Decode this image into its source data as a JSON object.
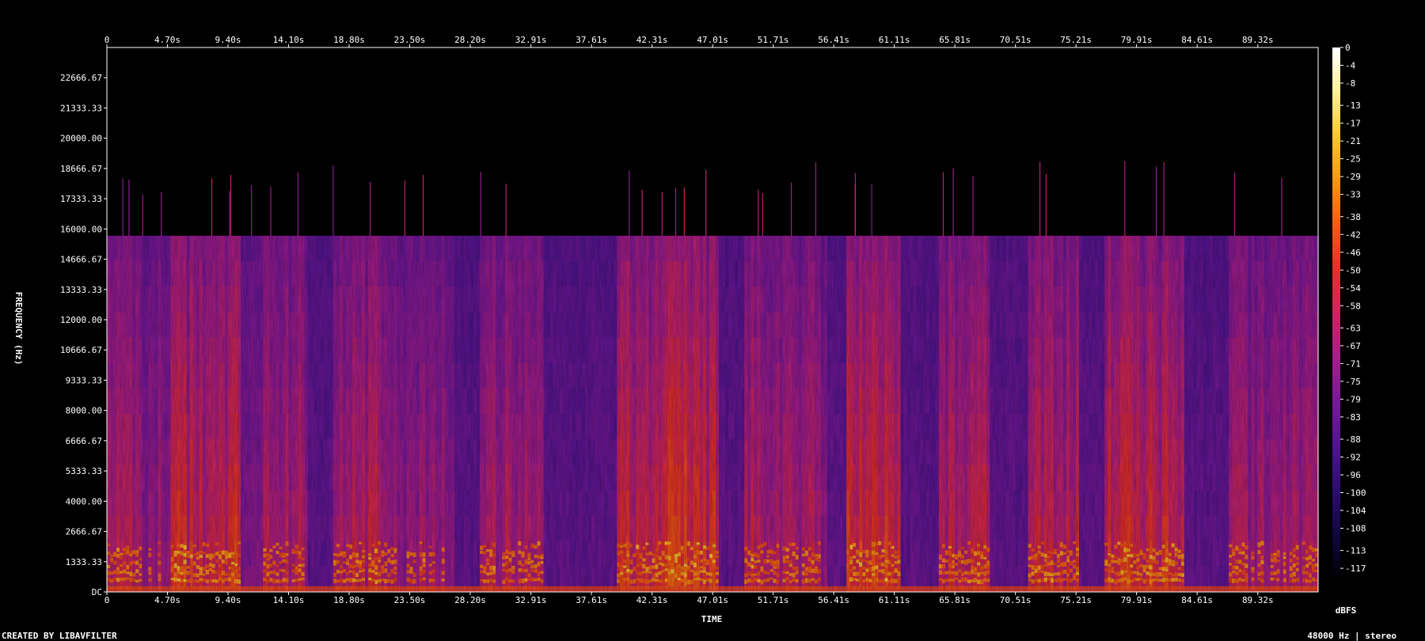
{
  "chart_data": {
    "type": "heatmap",
    "xlabel": "TIME",
    "ylabel": "FREQUENCY (Hz)",
    "x_ticks": [
      "0",
      "4.70s",
      "9.40s",
      "14.10s",
      "18.80s",
      "23.50s",
      "28.20s",
      "32.91s",
      "37.61s",
      "42.31s",
      "47.01s",
      "51.71s",
      "56.41s",
      "61.11s",
      "65.81s",
      "70.51s",
      "75.21s",
      "79.91s",
      "84.61s",
      "89.32s"
    ],
    "x_tick_values": [
      0,
      4.7,
      9.4,
      14.1,
      18.8,
      23.5,
      28.2,
      32.91,
      37.61,
      42.31,
      47.01,
      51.71,
      56.41,
      61.11,
      65.81,
      70.51,
      75.21,
      79.91,
      84.61,
      89.32
    ],
    "x_range": [
      0,
      94.0
    ],
    "y_ticks": [
      "DC",
      "1333.33",
      "2666.67",
      "4000.00",
      "5333.33",
      "6666.67",
      "8000.00",
      "9333.33",
      "10666.67",
      "12000.00",
      "13333.33",
      "14666.67",
      "16000.00",
      "17333.33",
      "18666.67",
      "20000.00",
      "21333.33",
      "22666.67"
    ],
    "y_tick_values": [
      0,
      1333.33,
      2666.67,
      4000,
      5333.33,
      6666.67,
      8000,
      9333.33,
      10666.67,
      12000,
      13333.33,
      14666.67,
      16000,
      17333.33,
      18666.67,
      20000,
      21333.33,
      22666.67
    ],
    "y_range": [
      0,
      24000
    ],
    "cutoff_hz": 15700,
    "colorbar": {
      "unit": "dBFS",
      "ticks": [
        "0",
        "-4",
        "-8",
        "-13",
        "-17",
        "-21",
        "-25",
        "-29",
        "-33",
        "-38",
        "-42",
        "-46",
        "-50",
        "-54",
        "-58",
        "-63",
        "-67",
        "-71",
        "-75",
        "-79",
        "-83",
        "-88",
        "-92",
        "-96",
        "-100",
        "-104",
        "-108",
        "-113",
        "-117"
      ],
      "range": [
        -120,
        0
      ],
      "colors": [
        "#000000",
        "#10063a",
        "#2a0c6e",
        "#4d1490",
        "#77189a",
        "#a51d8a",
        "#cc2460",
        "#e62e2a",
        "#f45a14",
        "#fa9412",
        "#fcc630",
        "#fef098",
        "#ffffff"
      ]
    },
    "loud_segments": [
      {
        "t0": 0.0,
        "t1": 2.3,
        "level": 0.55
      },
      {
        "t0": 2.3,
        "t1": 5.0,
        "level": 0.45
      },
      {
        "t0": 5.0,
        "t1": 10.5,
        "level": 0.75
      },
      {
        "t0": 10.5,
        "t1": 12.0,
        "level": 0.35
      },
      {
        "t0": 12.0,
        "t1": 15.5,
        "level": 0.55
      },
      {
        "t0": 17.5,
        "t1": 21.5,
        "level": 0.6
      },
      {
        "t0": 21.5,
        "t1": 27.0,
        "level": 0.4
      },
      {
        "t0": 29.0,
        "t1": 33.8,
        "level": 0.55
      },
      {
        "t0": 39.5,
        "t1": 43.5,
        "level": 0.7
      },
      {
        "t0": 43.5,
        "t1": 47.5,
        "level": 0.8
      },
      {
        "t0": 49.5,
        "t1": 53.0,
        "level": 0.6
      },
      {
        "t0": 53.0,
        "t1": 56.0,
        "level": 0.5
      },
      {
        "t0": 57.5,
        "t1": 61.5,
        "level": 0.75
      },
      {
        "t0": 64.5,
        "t1": 68.5,
        "level": 0.65
      },
      {
        "t0": 71.5,
        "t1": 75.5,
        "level": 0.6
      },
      {
        "t0": 77.5,
        "t1": 83.5,
        "level": 0.75
      },
      {
        "t0": 87.0,
        "t1": 94.0,
        "level": 0.5
      }
    ],
    "annotations": {
      "footer_left": "CREATED BY LIBAVFILTER",
      "footer_right": "48000 Hz | stereo"
    }
  }
}
